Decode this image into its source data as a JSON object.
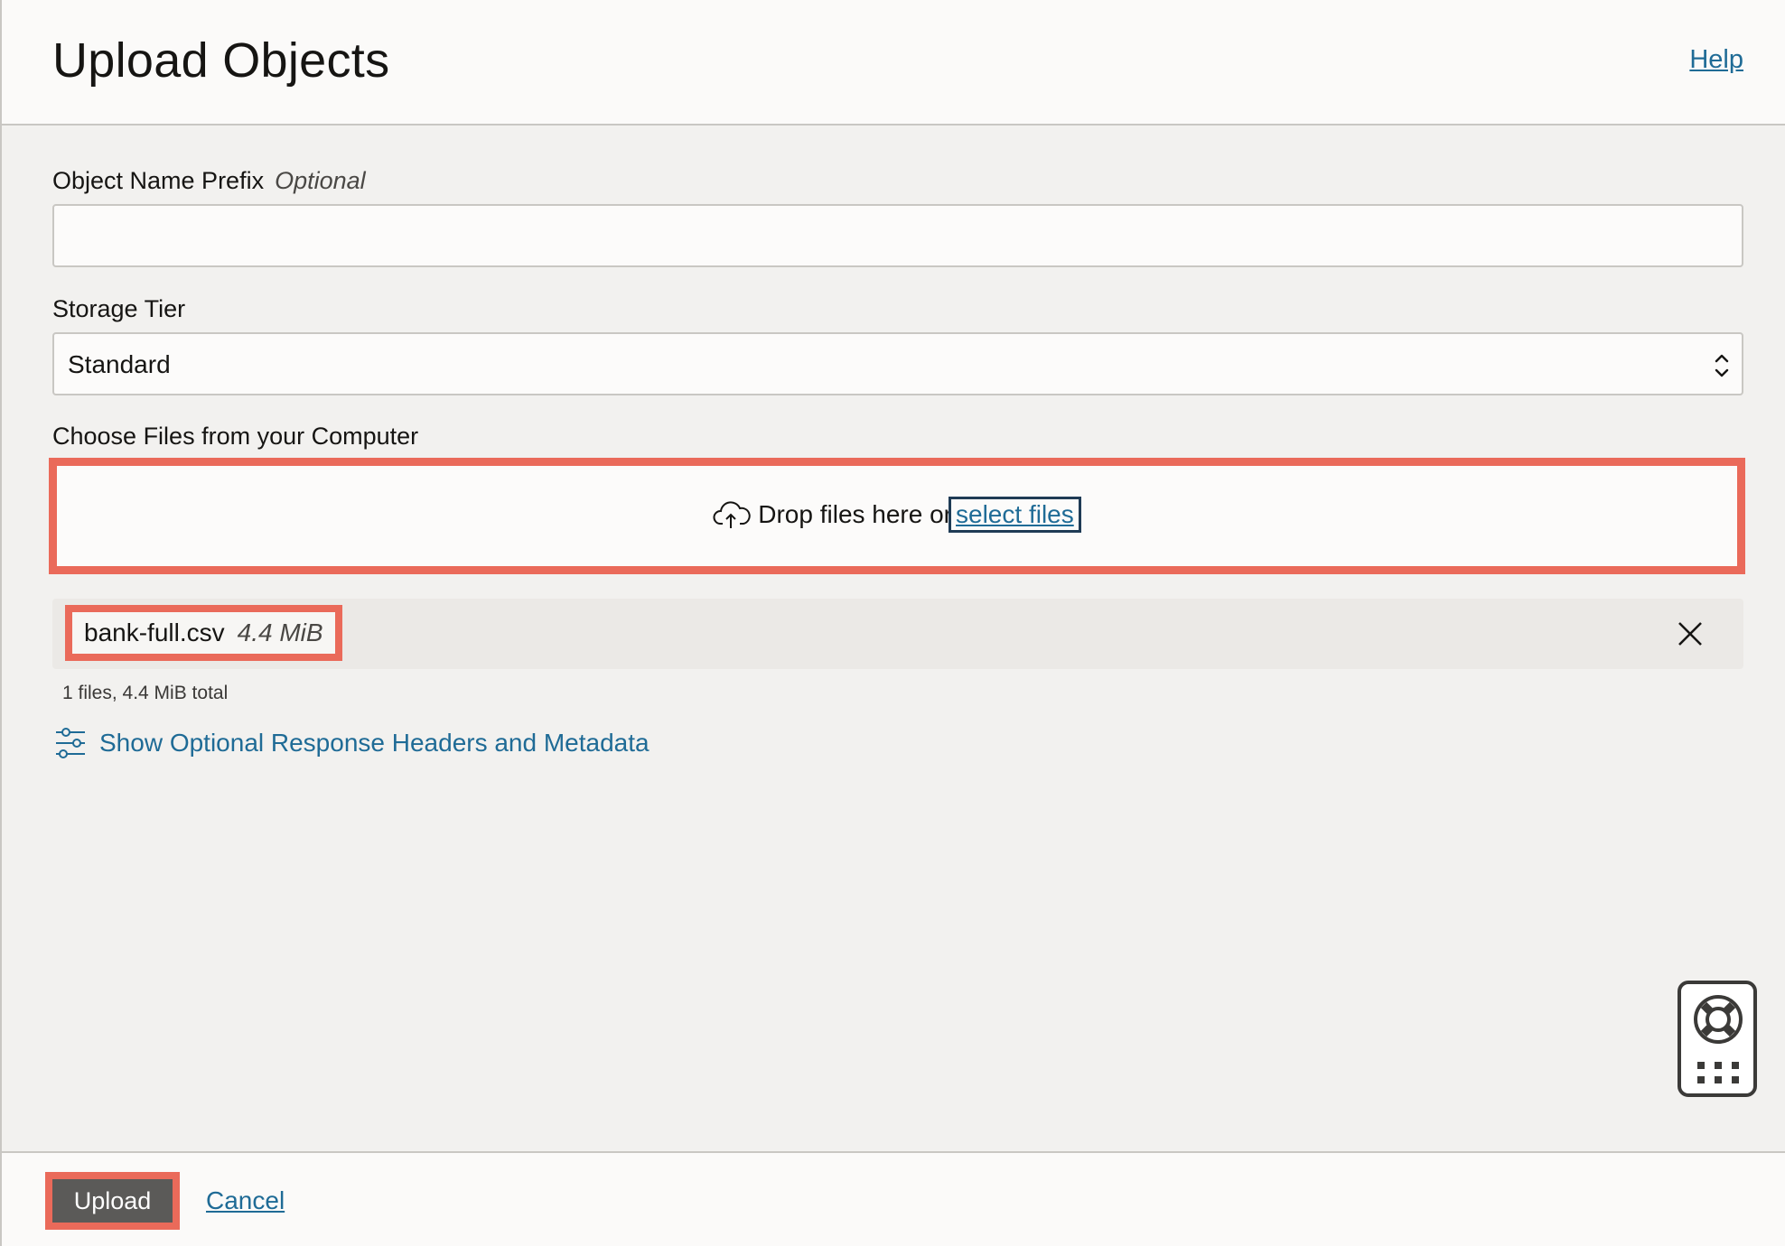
{
  "header": {
    "title": "Upload Objects",
    "help_link": "Help"
  },
  "form": {
    "prefix": {
      "label": "Object Name Prefix",
      "optional_tag": "Optional",
      "value": "",
      "placeholder": ""
    },
    "storage_tier": {
      "label": "Storage Tier",
      "selected": "Standard"
    },
    "file_chooser": {
      "label": "Choose Files from your Computer",
      "drop_text": "Drop files here or",
      "select_link": "select files",
      "icon": "cloud-upload-icon"
    },
    "files": [
      {
        "name": "bank-full.csv",
        "size": "4.4 MiB"
      }
    ],
    "summary": "1 files, 4.4 MiB total",
    "optional_headers_link": "Show Optional Response Headers and Metadata"
  },
  "footer": {
    "upload_label": "Upload",
    "cancel_label": "Cancel"
  },
  "colors": {
    "accent_link": "#1f6b96",
    "highlight": "#ea6a5a",
    "primary_button": "#5b5a58"
  }
}
